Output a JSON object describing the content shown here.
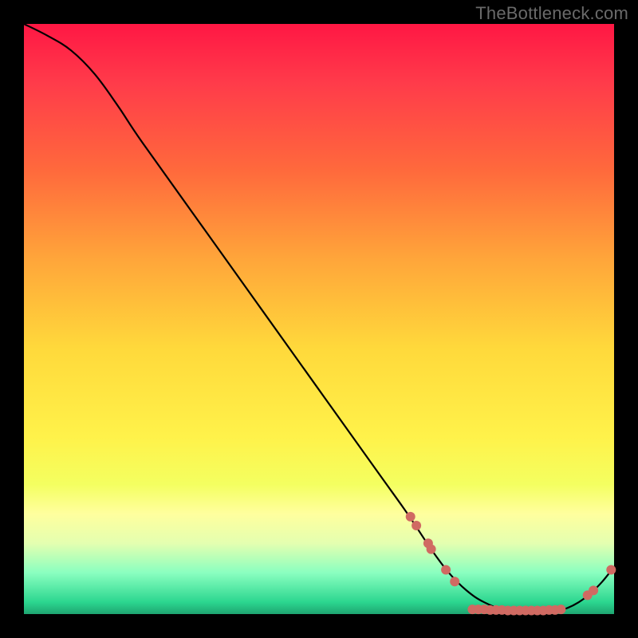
{
  "watermark": "TheBottleneck.com",
  "chart_data": {
    "type": "line",
    "title": "",
    "xlabel": "",
    "ylabel": "",
    "xlim": [
      0,
      100
    ],
    "ylim": [
      0,
      100
    ],
    "curve_x": [
      0,
      4,
      8,
      12,
      16,
      20,
      30,
      40,
      50,
      60,
      65,
      69,
      72,
      75,
      78,
      82,
      86,
      90,
      92,
      94,
      96,
      98,
      100
    ],
    "curve_y": [
      100,
      98,
      95.5,
      91.5,
      86,
      80,
      66,
      52,
      38,
      24,
      17,
      11,
      7,
      4,
      2,
      0.5,
      0.5,
      0.5,
      1,
      2,
      3.5,
      5.5,
      8
    ],
    "markers": [
      {
        "x": 65.5,
        "y": 16.5
      },
      {
        "x": 66.5,
        "y": 15.0
      },
      {
        "x": 68.5,
        "y": 12.0
      },
      {
        "x": 69.0,
        "y": 11.0
      },
      {
        "x": 71.5,
        "y": 7.5
      },
      {
        "x": 73.0,
        "y": 5.5
      },
      {
        "x": 76.0,
        "y": 0.8
      },
      {
        "x": 77.0,
        "y": 0.8
      },
      {
        "x": 78.0,
        "y": 0.8
      },
      {
        "x": 79.0,
        "y": 0.7
      },
      {
        "x": 80.0,
        "y": 0.7
      },
      {
        "x": 81.0,
        "y": 0.7
      },
      {
        "x": 82.0,
        "y": 0.6
      },
      {
        "x": 83.0,
        "y": 0.6
      },
      {
        "x": 84.0,
        "y": 0.6
      },
      {
        "x": 85.0,
        "y": 0.6
      },
      {
        "x": 86.0,
        "y": 0.6
      },
      {
        "x": 87.0,
        "y": 0.6
      },
      {
        "x": 88.0,
        "y": 0.6
      },
      {
        "x": 89.0,
        "y": 0.7
      },
      {
        "x": 90.0,
        "y": 0.7
      },
      {
        "x": 91.0,
        "y": 0.8
      },
      {
        "x": 95.5,
        "y": 3.2
      },
      {
        "x": 96.5,
        "y": 4.0
      },
      {
        "x": 99.5,
        "y": 7.5
      }
    ],
    "marker_color": "#d06a62",
    "line_color": "#000000"
  }
}
